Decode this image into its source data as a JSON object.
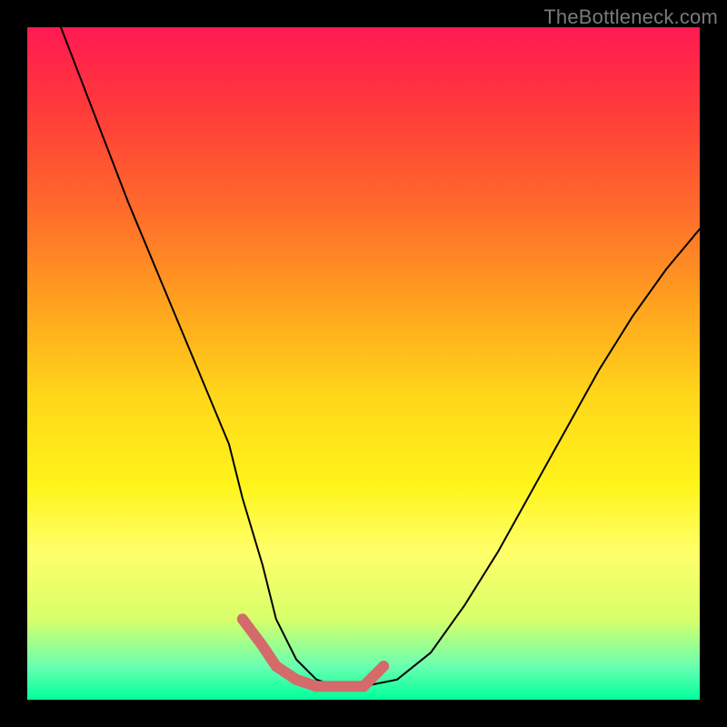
{
  "watermark": "TheBottleneck.com",
  "chart_data": {
    "type": "line",
    "title": "",
    "xlabel": "",
    "ylabel": "",
    "xlim": [
      0,
      100
    ],
    "ylim": [
      0,
      100
    ],
    "grid": false,
    "legend": false,
    "series": [
      {
        "name": "main-curve",
        "color": "#000000",
        "stroke_width": 2,
        "x": [
          5,
          10,
          15,
          20,
          25,
          30,
          32,
          35,
          37,
          40,
          43,
          46,
          50,
          55,
          60,
          65,
          70,
          75,
          80,
          85,
          90,
          95,
          100
        ],
        "y": [
          100,
          87,
          74,
          62,
          50,
          38,
          30,
          20,
          12,
          6,
          3,
          2,
          2,
          3,
          7,
          14,
          22,
          31,
          40,
          49,
          57,
          64,
          70
        ]
      },
      {
        "name": "highlight-segment",
        "color": "#d46a6a",
        "stroke_width": 12,
        "x": [
          32,
          35,
          37,
          40,
          43,
          46,
          50,
          53
        ],
        "y": [
          12,
          8,
          5,
          3,
          2,
          2,
          2,
          5
        ]
      }
    ],
    "annotations": []
  }
}
